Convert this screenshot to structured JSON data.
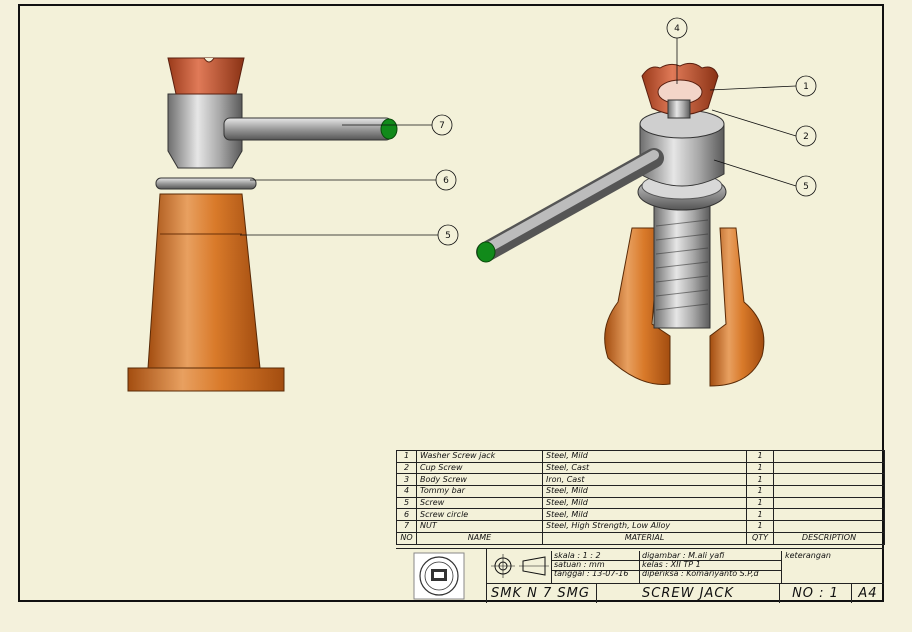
{
  "callouts": [
    "7",
    "6",
    "5",
    "4",
    "1",
    "2",
    "5"
  ],
  "bom": {
    "headers": {
      "no": "NO",
      "name": "NAME",
      "material": "MATERIAL",
      "qty": "QTY",
      "description": "DESCRIPTION"
    },
    "rows": [
      {
        "no": "1",
        "name": "Washer Screw jack",
        "material": "Steel, Mild",
        "qty": "1"
      },
      {
        "no": "2",
        "name": "Cup Screw",
        "material": "Steel, Cast",
        "qty": "1"
      },
      {
        "no": "3",
        "name": "Body Screw",
        "material": "Iron, Cast",
        "qty": "1"
      },
      {
        "no": "4",
        "name": "Tommy bar",
        "material": "Steel, Mild",
        "qty": "1"
      },
      {
        "no": "5",
        "name": "Screw",
        "material": "Steel, Mild",
        "qty": "1"
      },
      {
        "no": "6",
        "name": "Screw circle",
        "material": "Steel, Mild",
        "qty": "1"
      },
      {
        "no": "7",
        "name": "NUT",
        "material": "Steel, High Strength, Low Alloy",
        "qty": "1"
      }
    ]
  },
  "title_block": {
    "skala": "skala      : 1 : 2",
    "satuan": "satuan   : mm",
    "tanggal": "tanggal : 13-07-16",
    "digambar": "digambar  : M.ali yafi",
    "kelas": "kelas        : XII TP 1",
    "diperiksa": "diperiksa : Komariyanto S.P,d",
    "keterangan": "keterangan",
    "school": "SMK N 7 SMG",
    "title": "SCREW JACK",
    "number": "NO : 1",
    "size": "A4"
  }
}
